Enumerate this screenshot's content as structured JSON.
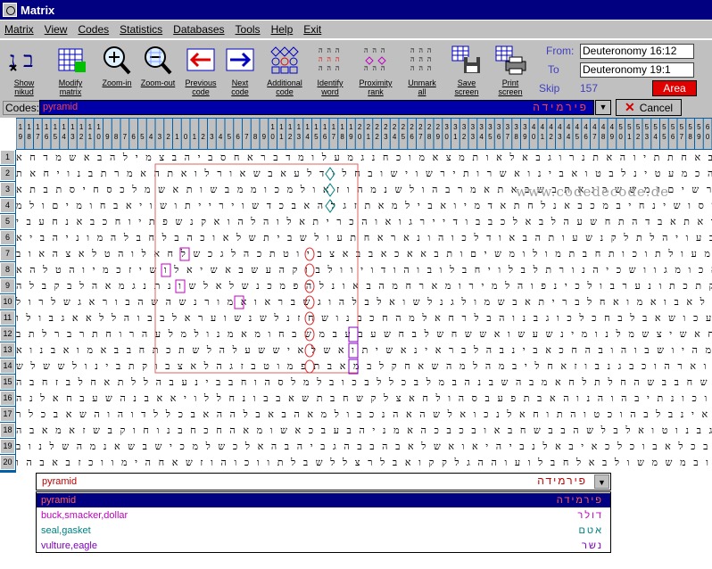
{
  "window": {
    "title": "Matrix"
  },
  "menu": [
    "Matrix",
    "View",
    "Codes",
    "Statistics",
    "Databases",
    "Tools",
    "Help",
    "Exit"
  ],
  "toolbar": [
    {
      "id": "show-nikud",
      "label": "Show\nnikud",
      "icon": "hebrew-letters-icon"
    },
    {
      "id": "modify-matrix",
      "label": "Modify\nmatrix",
      "icon": "grid-icon"
    },
    {
      "id": "zoom-in",
      "label": "Zoom-in",
      "icon": "magnifier-plus-icon"
    },
    {
      "id": "zoom-out",
      "label": "Zoom-out",
      "icon": "magnifier-minus-icon"
    },
    {
      "id": "previous-code",
      "label": "Previous\ncode",
      "icon": "arrow-left-icon"
    },
    {
      "id": "next-code",
      "label": "Next\ncode",
      "icon": "arrow-right-icon"
    },
    {
      "id": "additional-code",
      "label": "Additional\ncode",
      "icon": "diamond-grid-icon"
    },
    {
      "id": "identify-word",
      "label": "Identify\nword",
      "icon": "word-grid-icon"
    },
    {
      "id": "proximity-rank",
      "label": "Proximity\nrank",
      "icon": "proximity-icon"
    },
    {
      "id": "unmark-all",
      "label": "Unmark\nall",
      "icon": "unmark-icon"
    },
    {
      "id": "save-screen",
      "label": "Save\nscreen",
      "icon": "floppy-disk-icon"
    },
    {
      "id": "print-screen",
      "label": "Print\nscreen",
      "icon": "printer-icon"
    }
  ],
  "range": {
    "from_label": "From:",
    "from_value": "Deuteronomy 16:12",
    "to_label": "To",
    "to_value": "Deuteronomy 19:1"
  },
  "skip": {
    "label": "Skip",
    "value": "157"
  },
  "area_button": "Area",
  "codes": {
    "label": "Codes:",
    "value": "pyramid",
    "hebrew": "פירמידה",
    "cancel": "Cancel"
  },
  "column_numbers": [
    "19",
    "18",
    "17",
    "16",
    "15",
    "14",
    "13",
    "12",
    "11",
    "10",
    "9",
    "8",
    "7",
    "6",
    "5",
    "4",
    "3",
    "2",
    "1",
    "0",
    "1",
    "2",
    "3",
    "4",
    "5",
    "6",
    "7",
    "8",
    "9",
    "10",
    "11",
    "12",
    "13",
    "14",
    "15",
    "16",
    "17",
    "18",
    "19",
    "20",
    "21",
    "22",
    "23",
    "24",
    "25",
    "26",
    "27",
    "28",
    "29",
    "30",
    "31",
    "32",
    "33",
    "34",
    "35",
    "36",
    "37",
    "38",
    "39",
    "40",
    "41",
    "42",
    "43",
    "44",
    "45",
    "46",
    "47",
    "48",
    "49",
    "50",
    "51",
    "52",
    "53",
    "54",
    "55",
    "56",
    "57",
    "58",
    "59",
    "60"
  ],
  "row_numbers": [
    "1",
    "2",
    "3",
    "4",
    "5",
    "6",
    "7",
    "8",
    "9",
    "10",
    "11",
    "12",
    "13",
    "14",
    "15",
    "16",
    "17",
    "18",
    "19",
    "20"
  ],
  "rows": [
    "לשהאחרמבנכארואחתתערזאבאחתתיוהאתנרוגבאלאותמצאמוכחנגמעלומדבראחסביהבצמילהבאשמדחא",
    "הבקשסוכחצאקינמקשחכמדהכמעטינלבטואבינואשרותירשוישובחלודלעאבשאורלואתהאמרתבנויחאת",
    "משחתעתנבלשאבוהקליאחדארשיםומששכנאתבשבאתאמרבהולשנמהוזאולמכוממבשותאשמלכסחיסתבתא",
    "שרשולאהימכלבקעמויחוסושינחיבמכבאנלחתאדמיואבילמאתזגלהאבכדשוירייתושויאבחומיםולמ",
    "אבלוללתניהיכוניששהואתאבדהתחשעהלבאלכבבודיירגואוהכריתאלוהלהואקנשפתיוחכבאנחעבי",
    "הלשאשראתבנילאבלבלגבעויהלתלקנשעותהבאודלכוהונאראחתעולשביתשלאוכהבלחבלהמוניהביא",
    "אחוקנשמלהוגבשעשתכרכלמעולתוכותחבתמולומשיםותבאאכאבבאצביוטתכהלגכשלחאלוהטלאצהאוב",
    "הולהורבתבלתעבאלנאכומגוושכיהנורתלבלויחבלובוהודויוולבוקהעשבאשיאלושיזכמיוהטלהא",
    "רבוהואחתאלבוכראשחמקתכתונערבולכינפוהלמירומארחמהבאונלהפמכנשלאלשונתנגמאהלבקבלה",
    "שמעבלתינכבלנוונהלאשדלאבואמואחלבריתאבשמולגנלשואלבלהוגשבראואמורנשהשהבוראגשלרול",
    "בחהלעליויתקבלשבתשילעכושאבלבחכלכוגבנוהבלרחאלמהחכבנושחזנלשנשועראלבבוהללאאגבולו",
    "אבצגלצנעבבראמבוומבושאחאשיצשמלנומינשעשואששחשלבחשעבעבמשבחומאמנולמלעהרוחתרברלתב",
    "מוודנהוכיובבחאתנוהיאמהיושבוהובהחכאבינבהלבראינאשיתואשלאיששעלהלשתכתחבבאמואבנוא",
    "ואנוכבשתוחשבאאכהנשכוארהוכבגנבוזאחליבמהלמהשאחקלבמאבתפמוטבזגהלאצבוקתבינולששלש",
    "ראשנולאשבמראבובינהראשחבבשהחלתלחאמבהשבנהבמלבכללבכובלמלסהוחבבינעבהללתאחלבזחבה",
    "לעבכוובלחשרועבכתהוגבוכונתיבהוהנוהאבתפעבסהולחאצלקשחבתשאבבונחללויאאבנהשעבחאלנה",
    "יבבשאלוזבנהשמינבשיכבאינבלבהוכטוהתוחאלנכואלשהאהנכבולמאהבאבלההאבכללדוהוהשאבכלר",
    "הכנביבלינמלמיחאלוחגמגבנוטואלבלשהבבשחבאובכבכהאמניהבעבכאשומאהחכחבנוחוקבשזאמאבה",
    "חסאבשקשפושהשבנוהומאדבכלאבוכלכאיבאלנביהיאואשלאבהבבהגביהבהאלכשלמכישבשאנמהשלנוב",
    "במאכשכאתבהאנצבשאהלובמשמשולבאלחבלועוההגלקקואבלרצללשבלתווכוהוזשאחהימווכזבאבהו"
  ],
  "watermark": "www.codedecode.de",
  "legend": {
    "field_value": "pyramid",
    "field_hebrew": "פירמידה",
    "items": [
      {
        "label": "pyramid",
        "hebrew": "פירמידה",
        "color": "#ff6060",
        "selected": true
      },
      {
        "label": "buck,smacker,dollar",
        "hebrew": "דולר",
        "color": "#c000c0",
        "selected": false
      },
      {
        "label": "seal,gasket",
        "hebrew": "אטם",
        "color": "#008080",
        "selected": false
      },
      {
        "label": "vulture,eagle",
        "hebrew": "נשר",
        "color": "#8000c0",
        "selected": false
      }
    ]
  },
  "colors": {
    "titlebar": "#000080",
    "header": "#0060a8",
    "selection": "#0000a8",
    "area_box": "#e06060"
  }
}
